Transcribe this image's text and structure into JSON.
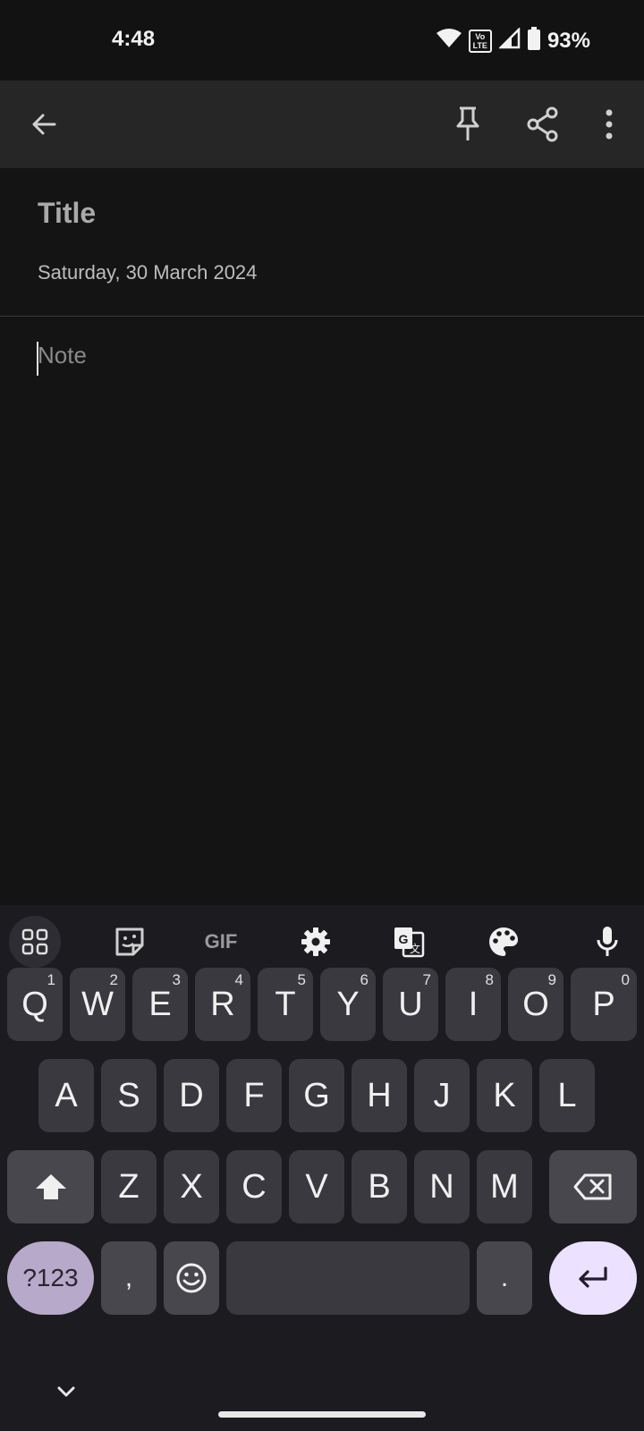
{
  "status_bar": {
    "time": "4:48",
    "battery": "93%",
    "volte_top": "Vo",
    "volte_bottom": "LTE"
  },
  "note": {
    "title_placeholder": "Title",
    "date": "Saturday, 30 March 2024",
    "body_placeholder": "Note"
  },
  "keyboard": {
    "toolbar": {
      "gif_label": "GIF"
    },
    "row1": [
      {
        "key": "Q",
        "hint": "1"
      },
      {
        "key": "W",
        "hint": "2"
      },
      {
        "key": "E",
        "hint": "3"
      },
      {
        "key": "R",
        "hint": "4"
      },
      {
        "key": "T",
        "hint": "5"
      },
      {
        "key": "Y",
        "hint": "6"
      },
      {
        "key": "U",
        "hint": "7"
      },
      {
        "key": "I",
        "hint": "8"
      },
      {
        "key": "O",
        "hint": "9"
      },
      {
        "key": "P",
        "hint": "0"
      }
    ],
    "row2": [
      "A",
      "S",
      "D",
      "F",
      "G",
      "H",
      "J",
      "K",
      "L"
    ],
    "row3": [
      "Z",
      "X",
      "C",
      "V",
      "B",
      "N",
      "M"
    ],
    "row4": {
      "symbols": "?123",
      "comma": ",",
      "period": "."
    }
  },
  "colors": {
    "background": "#141414",
    "app_bar": "#262626",
    "keyboard": "#1c1b20",
    "enter_key": "#ece1ff"
  }
}
